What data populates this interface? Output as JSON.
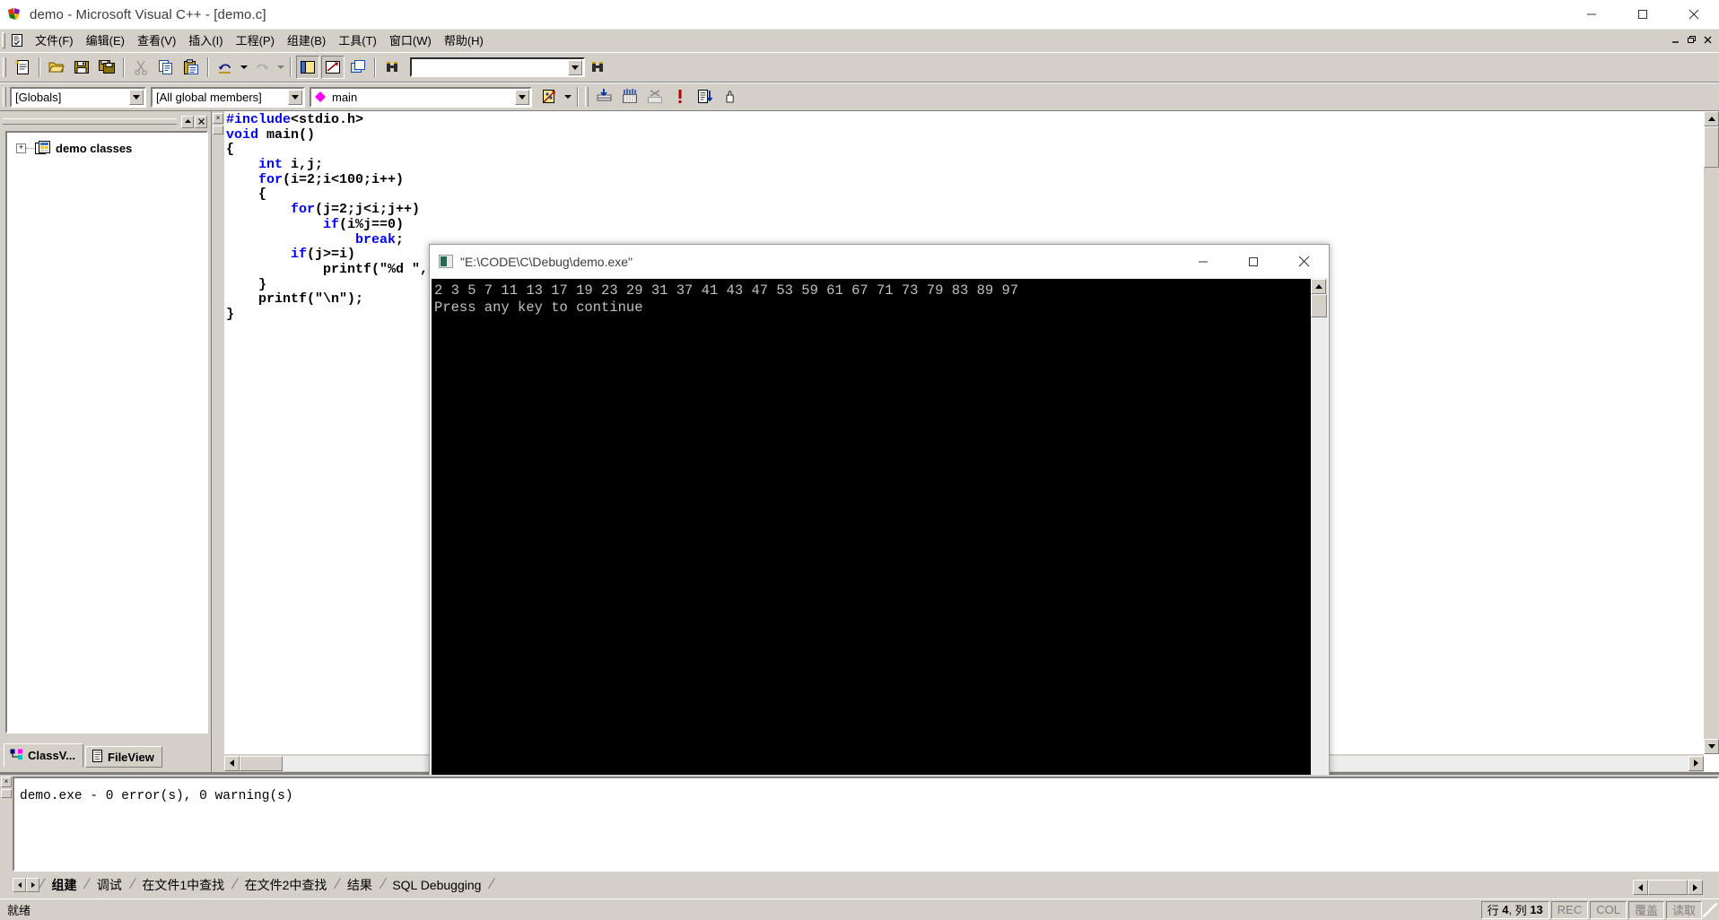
{
  "window": {
    "title": "demo - Microsoft Visual C++ - [demo.c]",
    "minimize": "minimize-icon",
    "maximize": "maximize-icon",
    "close": "close-icon"
  },
  "menubar": {
    "items": [
      {
        "label": "文件(F)",
        "name": "menu-file"
      },
      {
        "label": "编辑(E)",
        "name": "menu-edit"
      },
      {
        "label": "查看(V)",
        "name": "menu-view"
      },
      {
        "label": "插入(I)",
        "name": "menu-insert"
      },
      {
        "label": "工程(P)",
        "name": "menu-project"
      },
      {
        "label": "组建(B)",
        "name": "menu-build"
      },
      {
        "label": "工具(T)",
        "name": "menu-tools"
      },
      {
        "label": "窗口(W)",
        "name": "menu-window"
      },
      {
        "label": "帮助(H)",
        "name": "menu-help"
      }
    ],
    "mdi_buttons": [
      "_",
      "□",
      "✕"
    ]
  },
  "toolbar_standard": {
    "buttons": [
      {
        "name": "new-text-file-icon",
        "title": "New Text File"
      },
      {
        "name": "open-folder-icon",
        "title": "Open"
      },
      {
        "name": "save-icon",
        "title": "Save"
      },
      {
        "name": "save-all-icon",
        "title": "Save All"
      },
      {
        "name": "cut-scissors-icon",
        "title": "Cut"
      },
      {
        "name": "copy-icon",
        "title": "Copy"
      },
      {
        "name": "paste-icon",
        "title": "Paste"
      },
      {
        "name": "undo-icon",
        "title": "Undo"
      },
      {
        "name": "redo-icon",
        "title": "Redo"
      },
      {
        "name": "workspace-window-icon",
        "title": "Workspace"
      },
      {
        "name": "output-window-icon",
        "title": "Output"
      },
      {
        "name": "window-list-icon",
        "title": "Windows"
      },
      {
        "name": "find-in-files-binoculars-icon",
        "title": "Find in Files"
      }
    ],
    "find_value": "",
    "find_placeholder": ""
  },
  "toolbar_wizard": {
    "combo_globals": "[Globals]",
    "combo_members": "[All global members]",
    "combo_symbol": "main",
    "buttons": [
      {
        "name": "classwizard-icon",
        "title": "ClassWizard"
      },
      {
        "name": "compile-icon",
        "title": "Compile"
      },
      {
        "name": "build-icon",
        "title": "Build"
      },
      {
        "name": "stop-build-icon",
        "title": "Stop Build"
      },
      {
        "name": "execute-program-icon",
        "title": "Execute Program"
      },
      {
        "name": "go-debug-icon",
        "title": "Go"
      },
      {
        "name": "insert-breakpoint-hand-icon",
        "title": "Insert/Remove Breakpoint"
      }
    ]
  },
  "workspace_pane": {
    "tree_root": "demo classes",
    "tree_expander": "+",
    "tabs": [
      {
        "label": "ClassV...",
        "name": "tab-classview",
        "active": true
      },
      {
        "label": "FileView",
        "name": "tab-fileview",
        "active": false
      }
    ],
    "buttons": [
      "▲",
      "✕"
    ]
  },
  "editor": {
    "file": "demo.c",
    "code_lines": [
      [
        {
          "t": "#include",
          "c": "kw"
        },
        {
          "t": "<stdio.h>",
          "c": ""
        }
      ],
      [
        {
          "t": "void",
          "c": "kw"
        },
        {
          "t": " main()",
          "c": ""
        }
      ],
      [
        {
          "t": "{",
          "c": ""
        }
      ],
      [
        {
          "t": "    ",
          "c": ""
        },
        {
          "t": "int",
          "c": "kw"
        },
        {
          "t": " i,j;",
          "c": ""
        }
      ],
      [
        {
          "t": "    ",
          "c": ""
        },
        {
          "t": "for",
          "c": "kw"
        },
        {
          "t": "(i=2;i<100;i++)",
          "c": ""
        }
      ],
      [
        {
          "t": "    {",
          "c": ""
        }
      ],
      [
        {
          "t": "        ",
          "c": ""
        },
        {
          "t": "for",
          "c": "kw"
        },
        {
          "t": "(j=2;j<i;j++)",
          "c": ""
        }
      ],
      [
        {
          "t": "            ",
          "c": ""
        },
        {
          "t": "if",
          "c": "kw"
        },
        {
          "t": "(i%j==0)",
          "c": ""
        }
      ],
      [
        {
          "t": "                ",
          "c": ""
        },
        {
          "t": "break",
          "c": "kw"
        },
        {
          "t": ";",
          "c": ""
        }
      ],
      [
        {
          "t": "        ",
          "c": ""
        },
        {
          "t": "if",
          "c": "kw"
        },
        {
          "t": "(j>=i)",
          "c": ""
        }
      ],
      [
        {
          "t": "            printf(\"%d \",i);",
          "c": ""
        }
      ],
      [
        {
          "t": "    }",
          "c": ""
        }
      ],
      [
        {
          "t": "    printf(\"\\n\");",
          "c": ""
        }
      ],
      [
        {
          "t": "}",
          "c": ""
        }
      ]
    ]
  },
  "console": {
    "title": "\"E:\\CODE\\C\\Debug\\demo.exe\"",
    "icon": "console-window-icon",
    "output_lines": [
      "2 3 5 7 11 13 17 19 23 29 31 37 41 43 47 53 59 61 67 71 73 79 83 89 97",
      "Press any key to continue"
    ],
    "buttons": {
      "minimize": "–",
      "maximize": "□",
      "close": "✕"
    }
  },
  "output_pane": {
    "text": "demo.exe - 0 error(s), 0 warning(s)",
    "tabs": [
      {
        "label": "组建",
        "active": true
      },
      {
        "label": "调试",
        "active": false
      },
      {
        "label": "在文件1中查找",
        "active": false
      },
      {
        "label": "在文件2中查找",
        "active": false
      },
      {
        "label": "结果",
        "active": false
      },
      {
        "label": "SQL Debugging",
        "active": false
      }
    ]
  },
  "statusbar": {
    "message": "就绪",
    "line_label": "行",
    "line_value": "4",
    "col_label": "列",
    "col_value": "13",
    "indicators": [
      "REC",
      "COL",
      "覆盖",
      "读取"
    ]
  }
}
